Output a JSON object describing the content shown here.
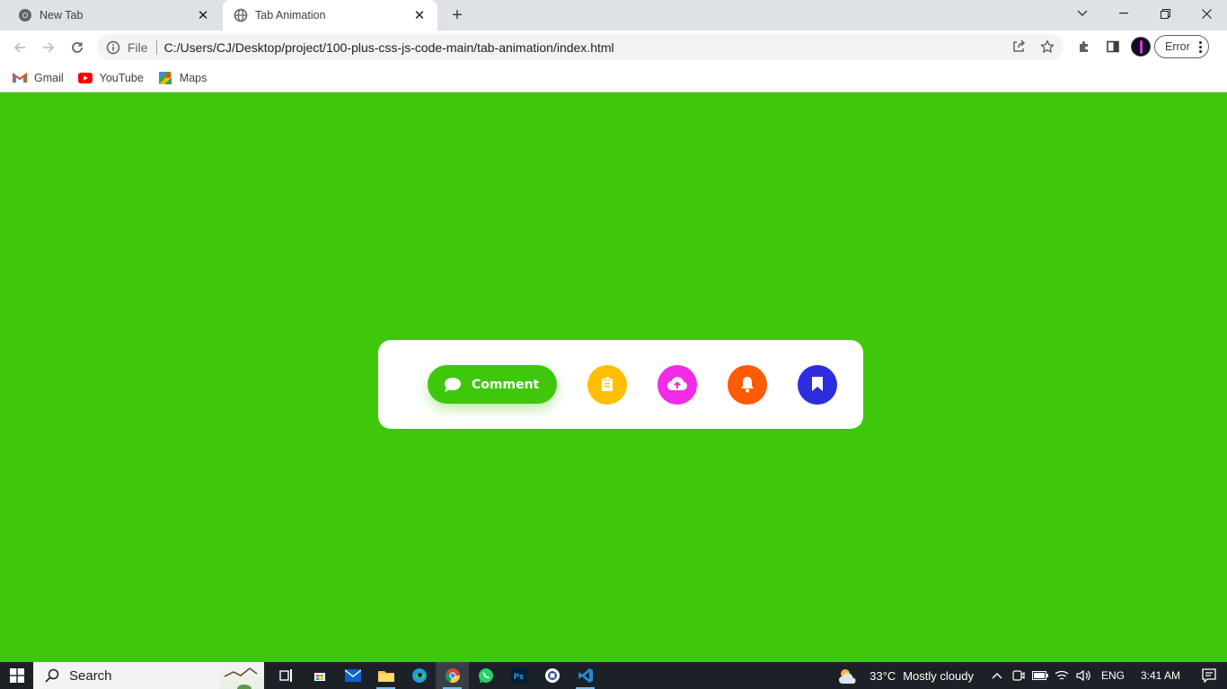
{
  "browser": {
    "tabs": [
      {
        "title": "New Tab",
        "icon": "chrome-icon",
        "active": false
      },
      {
        "title": "Tab Animation",
        "icon": "globe-icon",
        "active": true
      }
    ],
    "address": {
      "scheme_label": "File",
      "url": "C:/Users/CJ/Desktop/project/100-plus-css-js-code-main/tab-animation/index.html"
    },
    "profile_button_label": "Error",
    "bookmarks": [
      {
        "label": "Gmail",
        "icon": "gmail-icon"
      },
      {
        "label": "YouTube",
        "icon": "youtube-icon"
      },
      {
        "label": "Maps",
        "icon": "maps-icon"
      }
    ]
  },
  "page": {
    "background_color": "#3fc70c",
    "tabbar": {
      "active_label": "Comment",
      "items": [
        {
          "name": "comment",
          "icon": "chat-bubble-icon",
          "color": "#3fc70c",
          "active": true
        },
        {
          "name": "clipboard",
          "icon": "clipboard-icon",
          "color": "#ffbf00",
          "active": false
        },
        {
          "name": "cloud-upload",
          "icon": "cloud-upload-icon",
          "color": "#f22be6",
          "active": false
        },
        {
          "name": "notifications",
          "icon": "bell-icon",
          "color": "#ff5a06",
          "active": false
        },
        {
          "name": "bookmark",
          "icon": "bookmark-icon",
          "color": "#2d2ddf",
          "active": false
        }
      ]
    }
  },
  "taskbar": {
    "search_label": "Search",
    "weather": {
      "temp": "33°C",
      "condition": "Mostly cloudy"
    },
    "language": "ENG",
    "time": "3:41 AM"
  }
}
